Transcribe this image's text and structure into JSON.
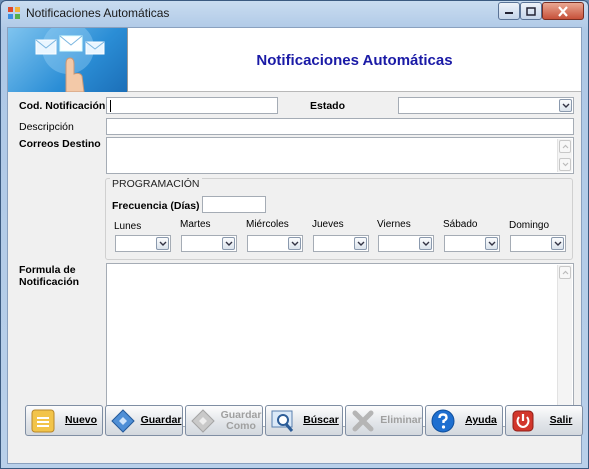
{
  "window": {
    "title": "Notificaciones Automáticas"
  },
  "banner": {
    "title": "Notificaciones Automáticas"
  },
  "form": {
    "cod_label": "Cod. Notificación",
    "cod_value": "",
    "estado_label": "Estado",
    "estado_value": "",
    "descripcion_label": "Descripción",
    "descripcion_value": "",
    "correos_label": "Correos Destino",
    "correos_value": "",
    "formula_label_1": "Formula de",
    "formula_label_2": "Notificación",
    "formula_value": ""
  },
  "programacion": {
    "group_label": "PROGRAMACIÓN",
    "frecuencia_label": "Frecuencia (Días)",
    "frecuencia_value": "",
    "days": [
      {
        "label": "Lunes",
        "value": ""
      },
      {
        "label": "Martes",
        "value": ""
      },
      {
        "label": "Miércoles",
        "value": ""
      },
      {
        "label": "Jueves",
        "value": ""
      },
      {
        "label": "Viernes",
        "value": ""
      },
      {
        "label": "Sábado",
        "value": ""
      },
      {
        "label": "Domingo",
        "value": ""
      }
    ]
  },
  "toolbar": {
    "nuevo": "Nuevo",
    "guardar": "Guardar",
    "guardar_como_1": "Guardar",
    "guardar_como_2": "Como",
    "buscar": "Búscar",
    "eliminar": "Eliminar",
    "ayuda": "Ayuda",
    "salir": "Salir"
  },
  "colors": {
    "banner_title": "#1a1aa6",
    "disabled_text": "#a0a0a0",
    "help_icon": "#1e6fd0",
    "exit_icon": "#d2362b"
  }
}
